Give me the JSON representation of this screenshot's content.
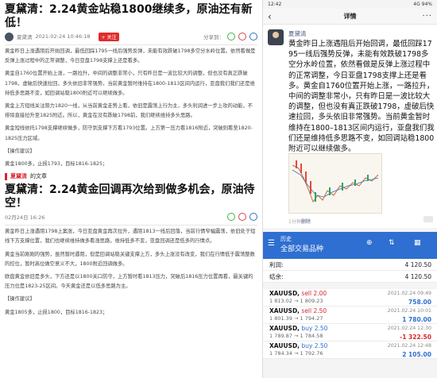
{
  "article1": {
    "title": "夏黛清：2.24黄金站稳1800继续多，原油还有新低！",
    "author": "夏黛清",
    "date": "2021-02-24 10:46:18",
    "follow_label": "+ 关注",
    "share_label": "分享到：",
    "paragraphs": [
      "黄金昨日上涨遇阻后开始回调，最低回踩1795一线后强势反弹，未能有效跌破1798多空分水岭位置。依然看做是反弹上涨过程中的正常调整，今日亚盘1798支撑上还是看多。",
      "黄金自1760位置开始上涨，一路拉升，中间的调整非常小，只有昨日是一波比较大的调整，但也没有真正跌破1798，虚破后快速拉回，多头依旧非常强势。当前黄金暂时维持在1800-1813区间内运行，亚盘我们我们还是维持低多思路不变，如回调站稳1800附近可以继续做多。",
      "黄金上方短线关注阻力1820一线，从当前黄金走势上看，依旧是震荡上行为主，多头利润进一步上攻的动能，不排除直接拉升至1825附近。所以，黄金在没有跌破1798前，我们继续维持多头思路。",
      "黄金短线依托1798支撑继续做多，防守到支撑下方看1793位置。上方第一压力看1816附近，突破则看至1820-1825压力区域。"
    ],
    "advice_header": "【操作建议】",
    "advice": "黄金1800多，止损1793，目标1816-1825；"
  },
  "section": {
    "name": "夏黛清",
    "suffix": "的文章"
  },
  "article2": {
    "title": "夏黛清：2.24黄金回调再次给到做多机会，原油待空！",
    "date": "02月24日 16:26",
    "paragraphs": [
      "黄金昨日上涨遇阻1798上案涨，今日亚盘黄金再次拉升，遇阻1813一线后回落，当前行情窄幅震荡，依旧处于短线下方支撑位置，我们也继续维持做多看涨思路，维持低多不变，亚盘回调还是低多的行情点。",
      "黄金当前刚刚的强势，虽然暂时遇阻，但是回调站稳关键支撑上方，多头上涨没有改变，我们在行情低于震荡整数的控位，暂时高位做空意义不大，1800附近回调做多。",
      "欧盘黄金依旧是多头，下方还是以1800关口防守，上方暂时看1813压力，突破后1816压力位置再看，最关键的压力位是1823-25区间。今天黄金还是以低多思路为主。"
    ],
    "advice_header": "【操作建议】",
    "advice": "黄金1805多，止损1800，目标1816-1823；"
  },
  "phone": {
    "status_time": "12:42",
    "status_right": "4G 94%",
    "screen_title": "详情",
    "poster_name": "夏黛清",
    "post_text": "黄金昨日上涨遇阻后开始回调，最低回踩1795一线后强势反弹，未能有效跌破1798多空分水岭位置，依然看做是反弹上涨过程中的正常调整，今日亚盘1798支撑上还是看多。黄金自1760位置开始上涨，一路拉升，中间的调整非常小，只有昨日是一波比较大的调整，但也没有真正跌破1798，虚破后快速拉回，多头依旧非常强势。当前黄金暂时维持在1800–1813区间内运行，亚盘我们我们还是维持低多思路不变，如回调站稳1800附近可以继续做多。",
    "post_time": "1分钟",
    "post_delete": "删除"
  },
  "trading": {
    "header_small": "历史",
    "header_main": "全部交易品种",
    "profit_label": "利润:",
    "profit_value": "4 120.50",
    "balance_label": "结余:",
    "balance_value": "4 120.50",
    "trades": [
      {
        "symbol": "XAUUSD,",
        "side": "sell 2.00",
        "side_type": "sell",
        "prices": "1 813.02 → 1 809.23",
        "time": "2021.02.24 09:49",
        "pnl": "758.00",
        "pnl_type": "pos"
      },
      {
        "symbol": "XAUUSD,",
        "side": "sell 2.50",
        "side_type": "sell",
        "prices": "1 801.39 → 1 794.27",
        "time": "2021.02.24 10:01",
        "pnl": "1 780.00",
        "pnl_type": "pos"
      },
      {
        "symbol": "XAUUSD,",
        "side": "buy 2.50",
        "side_type": "buy",
        "prices": "1 789.87 → 1 784.58",
        "time": "2021.02.24 12:30",
        "pnl": "-1 322.50",
        "pnl_type": "neg"
      },
      {
        "symbol": "XAUUSD,",
        "side": "buy 2.50",
        "side_type": "buy",
        "prices": "1 784.34 → 1 792.76",
        "time": "2021.02.24 12:48",
        "pnl": "2 105.00",
        "pnl_type": "pos"
      }
    ]
  },
  "colors": {
    "accent_blue": "#2f6fd1",
    "loss_red": "#d8262c",
    "follow_red": "#e12c2c"
  },
  "icons": [
    "back-arrow-icon",
    "more-icon",
    "menu-icon",
    "sort-icon",
    "add-order-icon",
    "wechat-icon",
    "weibo-icon",
    "qq-icon"
  ]
}
